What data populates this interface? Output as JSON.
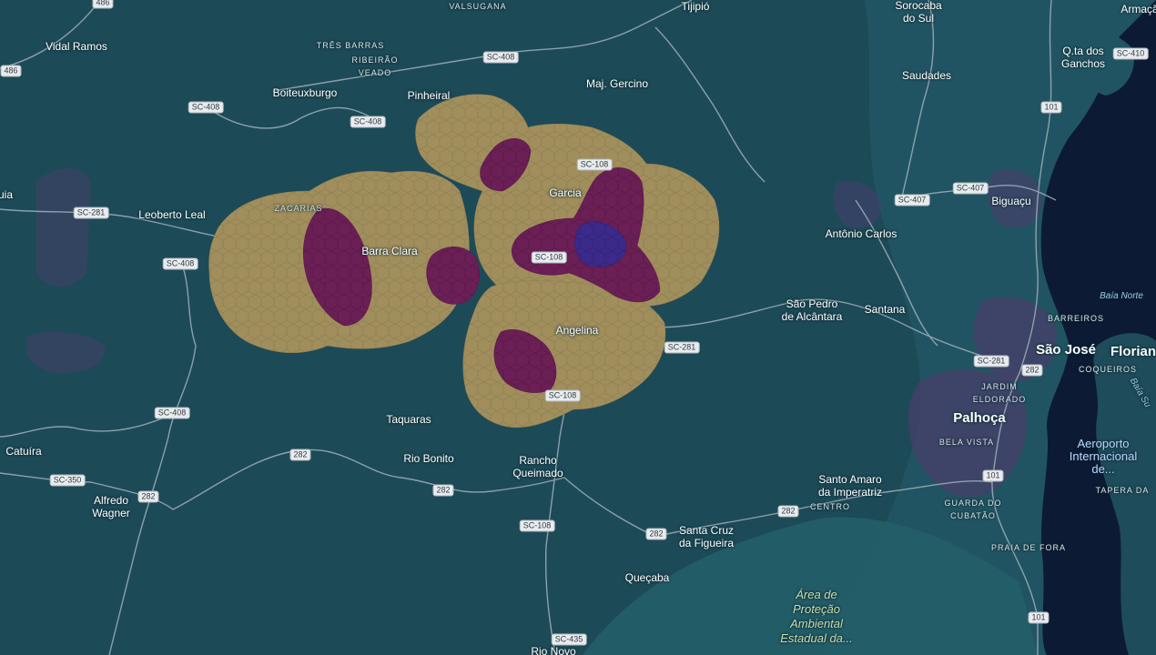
{
  "colors": {
    "land": "#1d4a57",
    "sea": "#0c1b33",
    "road": "#9fb0bb",
    "hex_tan": "#a08e5c",
    "hex_purple": "#6a1f55",
    "hex_blue": "#3b2a8a",
    "urban": "#45406a"
  },
  "places": [
    {
      "id": "vidal-ramos",
      "text": "Vidal Ramos"
    },
    {
      "id": "tres-barras",
      "text": "TRÊS BARRAS"
    },
    {
      "id": "ribeirao-veado",
      "text": "RIBEIRÃO\nVEADO"
    },
    {
      "id": "boiteuxburgo",
      "text": "Boiteuxburgo"
    },
    {
      "id": "pinheiral",
      "text": "Pinheiral"
    },
    {
      "id": "valsugana",
      "text": "VALSUGANA"
    },
    {
      "id": "tijipio",
      "text": "Tijipió"
    },
    {
      "id": "sorocaba-do-sul",
      "text": "Sorocaba\ndo Sul"
    },
    {
      "id": "armacao",
      "text": "Armaçã"
    },
    {
      "id": "qta-dos-ganchos",
      "text": "Q.ta dos\nGanchos"
    },
    {
      "id": "maj-gercino",
      "text": "Maj. Gercino"
    },
    {
      "id": "saudades",
      "text": "Saudades"
    },
    {
      "id": "uia",
      "text": "uia"
    },
    {
      "id": "leoberto-leal",
      "text": "Leoberto Leal"
    },
    {
      "id": "zacarias",
      "text": "ZACARIAS"
    },
    {
      "id": "barra-clara",
      "text": "Barra Clara"
    },
    {
      "id": "garcia",
      "text": "Garcia"
    },
    {
      "id": "biguacu",
      "text": "Biguaçu"
    },
    {
      "id": "antonio-carlos",
      "text": "Antônio Carlos"
    },
    {
      "id": "baia-norte",
      "text": "Baía Norte"
    },
    {
      "id": "sao-pedro",
      "text": "São Pedro\nde Alcântara"
    },
    {
      "id": "santana",
      "text": "Santana"
    },
    {
      "id": "barreiros",
      "text": "BARREIROS"
    },
    {
      "id": "angelina",
      "text": "Angelina"
    },
    {
      "id": "sao-jose",
      "text": "São José"
    },
    {
      "id": "florian",
      "text": "Florian"
    },
    {
      "id": "coqueiros",
      "text": "COQUEIROS"
    },
    {
      "id": "baia-sul",
      "text": "Baía Su"
    },
    {
      "id": "jardim-eldorado",
      "text": "JARDIM\nELDORADO"
    },
    {
      "id": "taquaras",
      "text": "Taquaras"
    },
    {
      "id": "palhoca",
      "text": "Palhoça"
    },
    {
      "id": "catuira",
      "text": "Catuíra"
    },
    {
      "id": "rio-bonito",
      "text": "Rio Bonito"
    },
    {
      "id": "bela-vista",
      "text": "BELA VISTA"
    },
    {
      "id": "aeroporto",
      "text": "Aeroporto\nInternacional\nde..."
    },
    {
      "id": "rancho-queimado",
      "text": "Rancho\nQueimado"
    },
    {
      "id": "santo-amaro",
      "text": "Santo Amaro\nda Imperatriz"
    },
    {
      "id": "centro",
      "text": "CENTRO"
    },
    {
      "id": "alfredo-wagner",
      "text": "Alfredo\nWagner"
    },
    {
      "id": "guarda-do-cubatao",
      "text": "GUARDA DO\nCUBATÃO"
    },
    {
      "id": "tapera-da",
      "text": "TAPERA DA"
    },
    {
      "id": "santa-cruz",
      "text": "Santa Cruz\nda Figueira"
    },
    {
      "id": "praia-de-fora",
      "text": "PRAIA DE FORA"
    },
    {
      "id": "quecaba",
      "text": "Queçaba"
    },
    {
      "id": "area-protecao",
      "text": "Área de\nProteção\nAmbiental\nEstadual da..."
    },
    {
      "id": "rio-novo",
      "text": "Rio Novo"
    }
  ],
  "shields": [
    {
      "id": "486-top",
      "text": "486"
    },
    {
      "id": "486-left",
      "text": "486"
    },
    {
      "id": "sc408-a",
      "text": "SC-408"
    },
    {
      "id": "sc408-b",
      "text": "SC-408"
    },
    {
      "id": "sc408-c",
      "text": "SC-408"
    },
    {
      "id": "sc408-d",
      "text": "SC-408"
    },
    {
      "id": "sc408-e",
      "text": "SC-408"
    },
    {
      "id": "sc281-a",
      "text": "SC-281"
    },
    {
      "id": "sc281-b",
      "text": "SC-281"
    },
    {
      "id": "sc281-c",
      "text": "SC-281"
    },
    {
      "id": "sc108-a",
      "text": "SC-108"
    },
    {
      "id": "sc108-b",
      "text": "SC-108"
    },
    {
      "id": "sc108-c",
      "text": "SC-108"
    },
    {
      "id": "sc108-d",
      "text": "SC-108"
    },
    {
      "id": "sc407-a",
      "text": "SC-407"
    },
    {
      "id": "sc407-b",
      "text": "SC-407"
    },
    {
      "id": "sc410",
      "text": "SC-410"
    },
    {
      "id": "101-a",
      "text": "101"
    },
    {
      "id": "101-b",
      "text": "101"
    },
    {
      "id": "101-c",
      "text": "101"
    },
    {
      "id": "282-a",
      "text": "282"
    },
    {
      "id": "282-b",
      "text": "282"
    },
    {
      "id": "282-c",
      "text": "282"
    },
    {
      "id": "282-d",
      "text": "282"
    },
    {
      "id": "282-e",
      "text": "282"
    },
    {
      "id": "282-f",
      "text": "282"
    },
    {
      "id": "sc350",
      "text": "SC-350"
    },
    {
      "id": "sc435",
      "text": "SC-435"
    }
  ]
}
